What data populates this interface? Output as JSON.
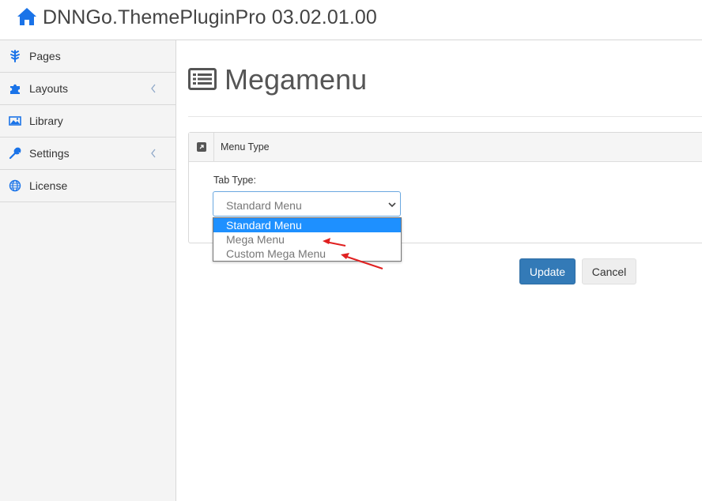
{
  "header": {
    "title": "DNNGo.ThemePluginPro 03.02.01.00",
    "icon": "home-icon"
  },
  "sidebar": {
    "items": [
      {
        "label": "Pages",
        "icon": "tree-icon",
        "has_submenu": false
      },
      {
        "label": "Layouts",
        "icon": "puzzle-icon",
        "has_submenu": true
      },
      {
        "label": "Library",
        "icon": "image-icon",
        "has_submenu": false
      },
      {
        "label": "Settings",
        "icon": "wrench-icon",
        "has_submenu": true
      },
      {
        "label": "License",
        "icon": "globe-icon",
        "has_submenu": false
      }
    ]
  },
  "main": {
    "title": "Megamenu",
    "title_icon": "list-icon"
  },
  "panel": {
    "title": "Menu Type",
    "field_label": "Tab Type:",
    "select": {
      "value": "Standard Menu",
      "options": [
        "Standard Menu",
        "Mega Menu",
        "Custom Mega Menu"
      ],
      "highlighted": "Standard Menu"
    }
  },
  "buttons": {
    "update": "Update",
    "cancel": "Cancel"
  },
  "colors": {
    "accent": "#337ab7",
    "option_highlight": "#1e90ff",
    "arrow": "#e02020",
    "home_icon": "#1a73e8"
  }
}
